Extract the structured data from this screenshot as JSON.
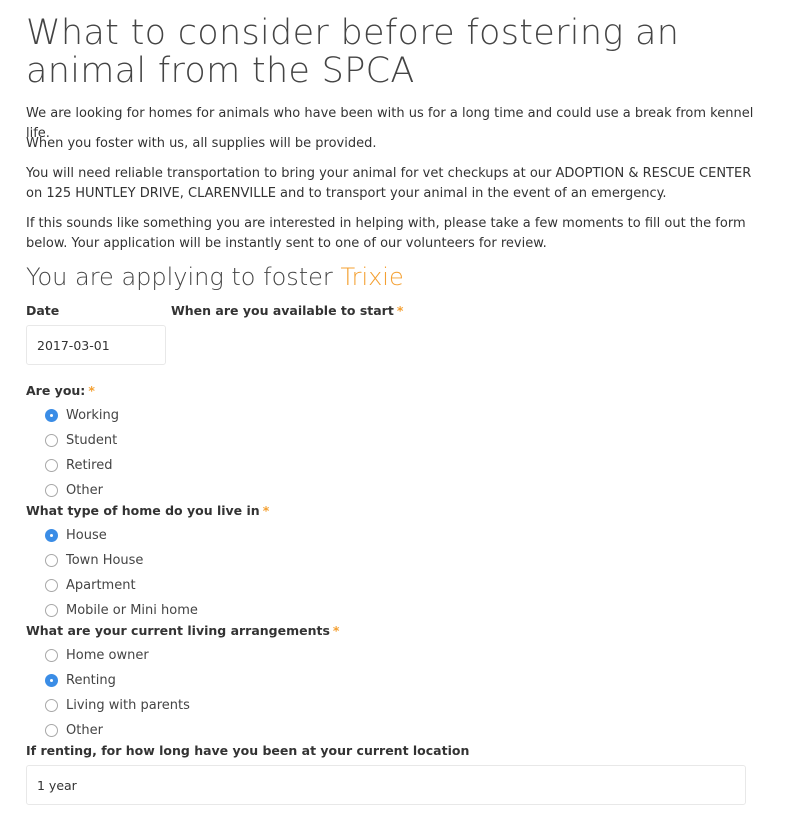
{
  "page": {
    "title": "What to consider before fostering an animal from the SPCA",
    "intro": [
      "We are looking for homes for animals who have been with us for a long time and could use a break from kennel life.",
      "When you foster with us, all supplies will be provided.",
      "You will need reliable transportation to bring your animal for vet checkups at our ADOPTION & RESCUE CENTER on 125 HUNTLEY DRIVE, CLARENVILLE and to transport your animal in the event of an emergency.",
      "If this sounds like something you are interested in helping with, please take a few moments to fill out the form below. Your application will be instantly sent to one of our volunteers for review."
    ],
    "subtitle_prefix": "You are applying to foster",
    "pet_name": "Trixie",
    "accent_color": "#f4a032",
    "radio_color": "#3b8de6"
  },
  "form": {
    "date_label": "Date",
    "date_value": "2017-03-01",
    "start_label": "When are you available to start",
    "required_mark": "*",
    "are_you": {
      "label": "Are you:",
      "options": [
        "Working",
        "Student",
        "Retired",
        "Other"
      ],
      "selected": "Working"
    },
    "home_type": {
      "label": "What type of home do you live in",
      "options": [
        "House",
        "Town House",
        "Apartment",
        "Mobile or Mini home"
      ],
      "selected": "House"
    },
    "living": {
      "label": "What are your current living arrangements",
      "options": [
        "Home owner",
        "Renting",
        "Living with parents",
        "Other"
      ],
      "selected": "Renting"
    },
    "renting_label": "If renting, for how long have you been at your current location",
    "renting_value": "1 year"
  }
}
